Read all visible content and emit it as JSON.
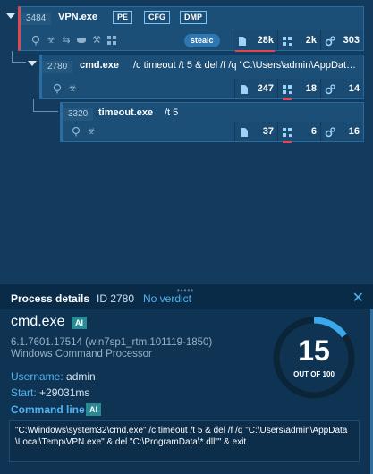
{
  "tree": {
    "rows": [
      {
        "pid": "3484",
        "name": "VPN.exe",
        "tags": [
          "PE",
          "CFG",
          "DMP"
        ],
        "badge": "stealc",
        "stats": {
          "files": "28k",
          "registry": "2k",
          "modules": "303"
        }
      },
      {
        "pid": "2780",
        "name": "cmd.exe",
        "command": "/c timeout /t 5 & del /f /q \"C:\\Users\\admin\\AppDat…",
        "stats": {
          "files": "247",
          "registry": "18",
          "modules": "14"
        }
      },
      {
        "pid": "3320",
        "name": "timeout.exe",
        "command": "/t 5",
        "stats": {
          "files": "37",
          "registry": "6",
          "modules": "16"
        }
      }
    ]
  },
  "details": {
    "header_title": "Process details",
    "id_text": "ID 2780",
    "verdict": "No verdict",
    "name": "cmd.exe",
    "ai_label": "AI",
    "version": "6.1.7601.17514 (win7sp1_rtm.101119-1850)",
    "description": "Windows Command Processor",
    "username_label": "Username:",
    "username": "admin",
    "start_label": "Start:",
    "start": "+29031ms",
    "command_line_label": "Command line",
    "command_line": "\"C:\\Windows\\system32\\cmd.exe\" /c timeout /t 5 & del /f /q \"C:\\Users\\admin\\AppData\\Local\\Temp\\VPN.exe\" & del \"C:\\ProgramData\\*.dll\"\" & exit",
    "score": "15",
    "score_out_of_label": "OUT OF",
    "score_max": "100",
    "score_fraction": 0.15
  },
  "colors": {
    "accent": "#4fb3f0",
    "alert": "#e2474e",
    "row_bg": "#1c4f78",
    "panel_bg": "#0f3453"
  }
}
